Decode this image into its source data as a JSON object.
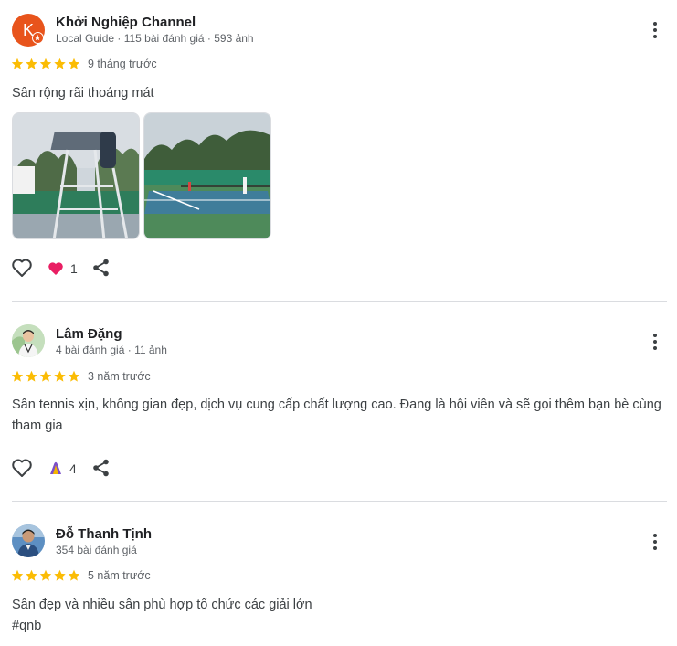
{
  "reviews": [
    {
      "author": "Khởi Nghiệp Channel",
      "avatar_letter": "K",
      "meta": "Local Guide · 115 bài đánh giá · 593 ảnh",
      "rating": 5,
      "time": "9 tháng trước",
      "text": "Sân rộng rãi thoáng mát",
      "reaction_icon": "heart-reaction",
      "reaction_count": "1"
    },
    {
      "author": "Lâm Đặng",
      "meta": "4 bài đánh giá · 11 ảnh",
      "rating": 5,
      "time": "3 năm trước",
      "text": "Sân tennis xịn, không gian đẹp, dịch vụ cung cấp chất lượng cao. Đang là hội viên và sẽ gọi thêm bạn bè cùng tham gia",
      "reaction_icon": "clap-reaction",
      "reaction_count": "4"
    },
    {
      "author": "Đỗ Thanh Tịnh",
      "meta": "354 bài đánh giá",
      "rating": 5,
      "time": "5 năm trước",
      "text": "Sân đẹp và nhiều sân phù hợp tổ chức các giải lớn",
      "hashtag": "#qnb"
    }
  ],
  "colors": {
    "star": "#fbbc04",
    "avatar_orange": "#e8541c",
    "heart_pink": "#e91e63",
    "text_secondary": "#5f6368",
    "divider": "#dadce0"
  }
}
